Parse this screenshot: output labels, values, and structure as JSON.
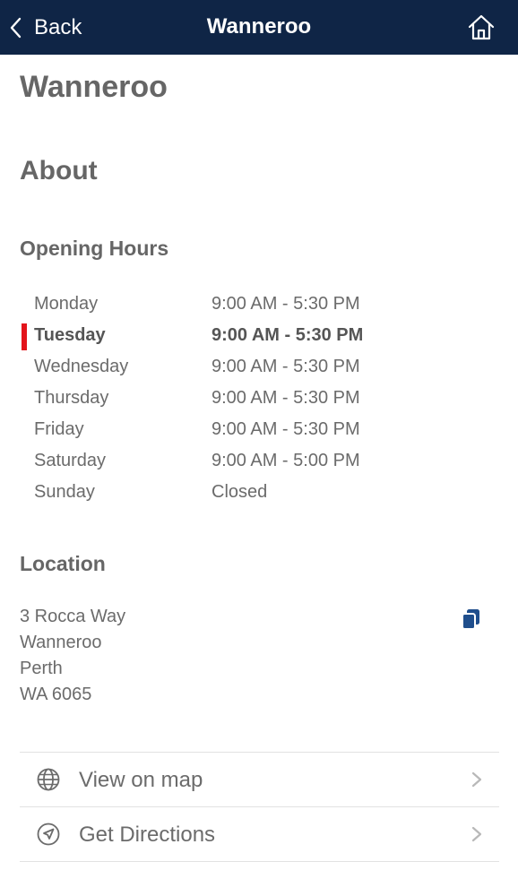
{
  "nav": {
    "back_label": "Back",
    "title": "Wanneroo"
  },
  "page": {
    "title": "Wanneroo",
    "about_heading": "About",
    "hours_heading": "Opening Hours",
    "location_heading": "Location"
  },
  "hours": [
    {
      "day": "Monday",
      "time": "9:00 AM - 5:30 PM",
      "today": false
    },
    {
      "day": "Tuesday",
      "time": "9:00 AM - 5:30 PM",
      "today": true
    },
    {
      "day": "Wednesday",
      "time": "9:00 AM - 5:30 PM",
      "today": false
    },
    {
      "day": "Thursday",
      "time": "9:00 AM - 5:30 PM",
      "today": false
    },
    {
      "day": "Friday",
      "time": "9:00 AM - 5:30 PM",
      "today": false
    },
    {
      "day": "Saturday",
      "time": "9:00 AM - 5:00 PM",
      "today": false
    },
    {
      "day": "Sunday",
      "time": "Closed",
      "today": false
    }
  ],
  "address": {
    "line1": "3 Rocca Way",
    "line2": "Wanneroo",
    "line3": "Perth",
    "line4": "WA 6065"
  },
  "actions": [
    {
      "label": "View on map",
      "icon": "globe-icon"
    },
    {
      "label": "Get Directions",
      "icon": "compass-arrow-icon"
    }
  ],
  "colors": {
    "navbar": "#0f2546",
    "today_marker": "#e3141b",
    "copy_icon": "#1f4e8c"
  }
}
